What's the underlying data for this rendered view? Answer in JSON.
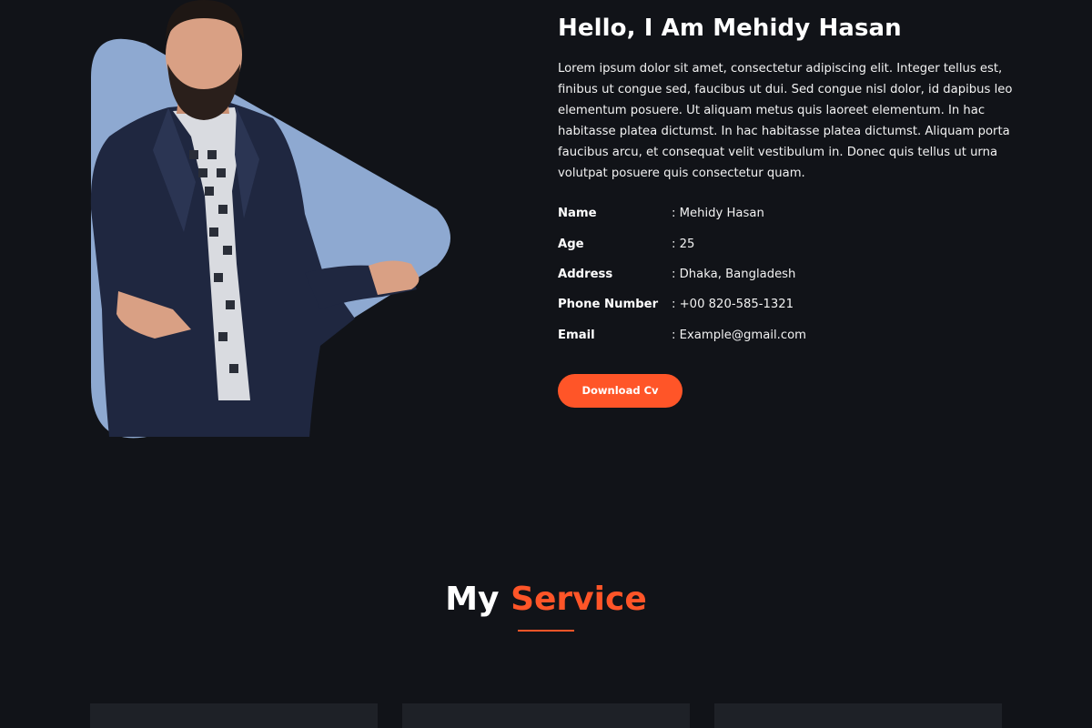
{
  "about": {
    "title": "Hello, I Am Mehidy Hasan",
    "description": "Lorem ipsum dolor sit amet, consectetur adipiscing elit. Integer tellus est, finibus ut congue sed, faucibus ut dui. Sed congue nisl dolor, id dapibus leo elementum posuere. Ut aliquam metus quis laoreet elementum. In hac habitasse platea dictumst. In hac habitasse platea dictumst. Aliquam porta faucibus arcu, et consequat velit vestibulum in. Donec quis tellus ut urna volutpat posuere quis consectetur quam.",
    "info": [
      {
        "label": "Name",
        "value": ": Mehidy Hasan"
      },
      {
        "label": "Age",
        "value": ": 25"
      },
      {
        "label": "Address",
        "value": ": Dhaka, Bangladesh"
      },
      {
        "label": "Phone Number",
        "value": ": +00 820-585-1321"
      },
      {
        "label": "Email",
        "value": ": Example@gmail.com"
      }
    ],
    "download_label": "Download Cv"
  },
  "services": {
    "heading_part1": "My",
    "heading_part2": "Service"
  },
  "colors": {
    "background": "#111318",
    "accent": "#ff5528",
    "shape": "#8ea9d1",
    "card": "#1e2127"
  }
}
